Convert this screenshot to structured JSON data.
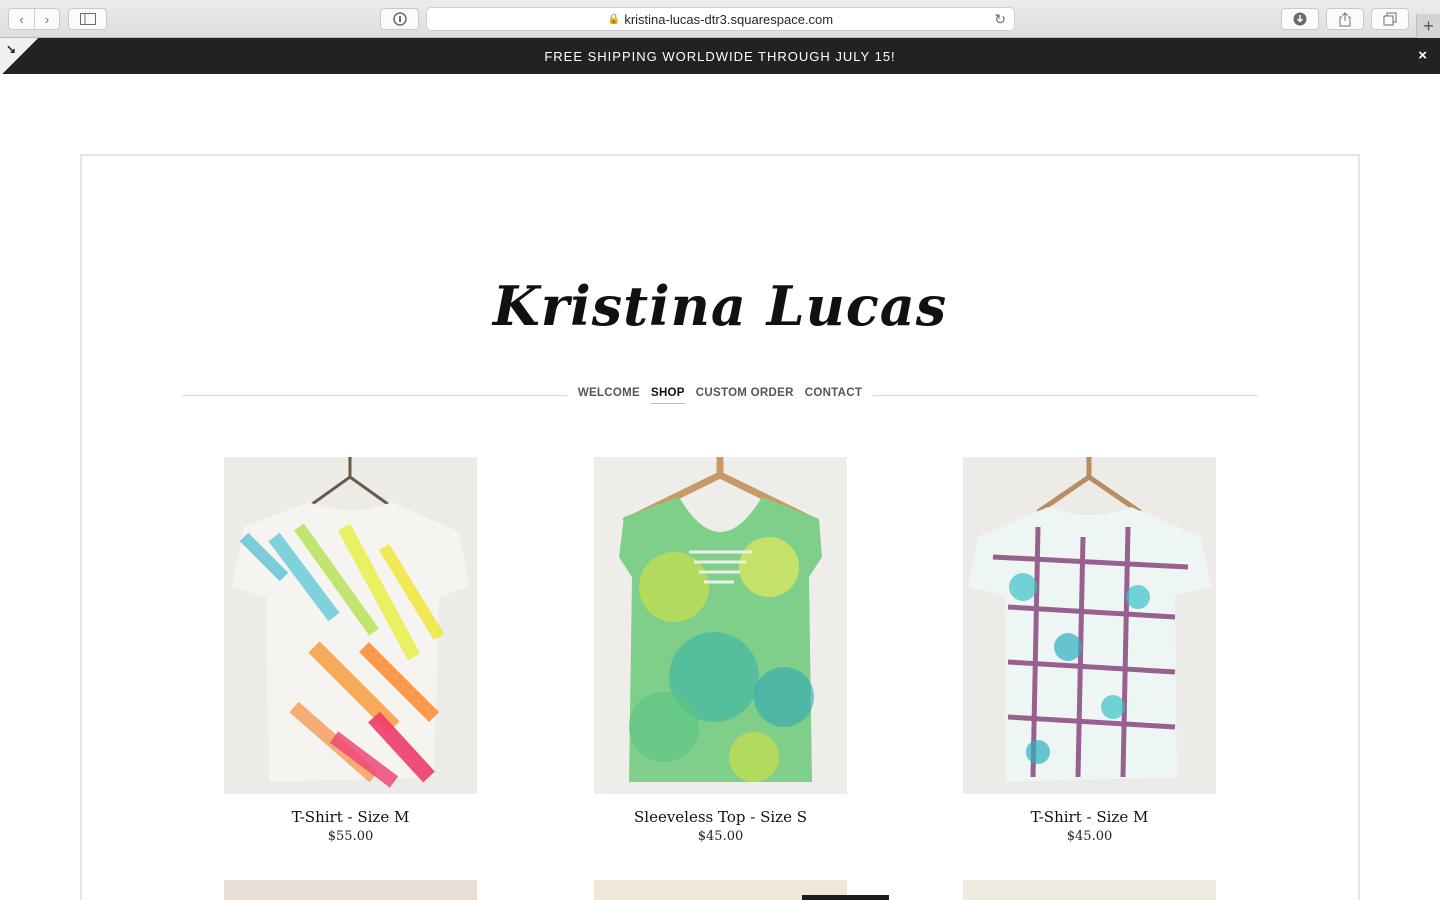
{
  "browser": {
    "url": "kristina-lucas-dtr3.squarespace.com",
    "icons": [
      "back-icon",
      "forward-icon",
      "sidebar-icon",
      "reader-icon",
      "lock-icon",
      "reload-icon",
      "download-icon",
      "share-icon",
      "tabs-icon",
      "new-tab-icon"
    ]
  },
  "announcement": {
    "text": "FREE SHIPPING WORLDWIDE THROUGH JULY 15!",
    "close": "×"
  },
  "site": {
    "logo": "Kristina Lucas",
    "nav": [
      {
        "label": "WELCOME",
        "active": false
      },
      {
        "label": "SHOP",
        "active": true
      },
      {
        "label": "CUSTOM ORDER",
        "active": false
      },
      {
        "label": "CONTACT",
        "active": false
      }
    ]
  },
  "products": [
    {
      "name": "T-Shirt - Size M",
      "price": "$55.00"
    },
    {
      "name": "Sleeveless Top - Size S",
      "price": "$45.00"
    },
    {
      "name": "T-Shirt - Size M",
      "price": "$45.00"
    }
  ]
}
